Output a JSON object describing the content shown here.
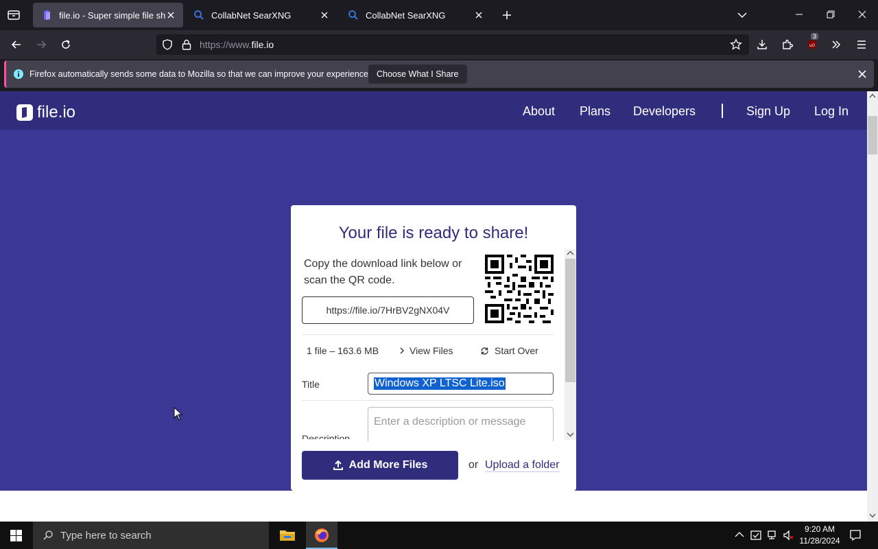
{
  "browser": {
    "tabs": [
      {
        "label": "file.io - Super simple file sharing",
        "active": true,
        "icon": "fileio-favicon"
      },
      {
        "label": "CollabNet SearXNG",
        "active": false,
        "icon": "search-icon"
      },
      {
        "label": "CollabNet SearXNG",
        "active": false,
        "icon": "search-icon"
      }
    ],
    "url_prefix": "https://www.",
    "url_domain": "file.io",
    "extension_badge": "3",
    "notification": {
      "text": "Firefox automatically sends some data to Mozilla so that we can improve your experience.",
      "button": "Choose What I Share"
    }
  },
  "site": {
    "logo": "file.io",
    "nav": {
      "about": "About",
      "plans": "Plans",
      "developers": "Developers",
      "signup": "Sign Up",
      "login": "Log In"
    },
    "colors": {
      "brand": "#2f2d7c",
      "background": "#3a3894"
    }
  },
  "card": {
    "title": "Your file is ready to share!",
    "instructions": "Copy the download link below or scan the QR code.",
    "link": "https://file.io/7HrBV2gNX04V",
    "file_info": "1 file – 163.6 MB",
    "view_files": "View Files",
    "start_over": "Start Over",
    "title_label": "Title",
    "title_value": "Windows XP LTSC Lite.iso",
    "description_label": "Description",
    "description_placeholder": "Enter a description or message",
    "add_more": "Add More Files",
    "or": "or",
    "upload_folder": "Upload a folder"
  },
  "taskbar": {
    "search_placeholder": "Type here to search",
    "time": "9:20 AM",
    "date": "11/28/2024"
  }
}
